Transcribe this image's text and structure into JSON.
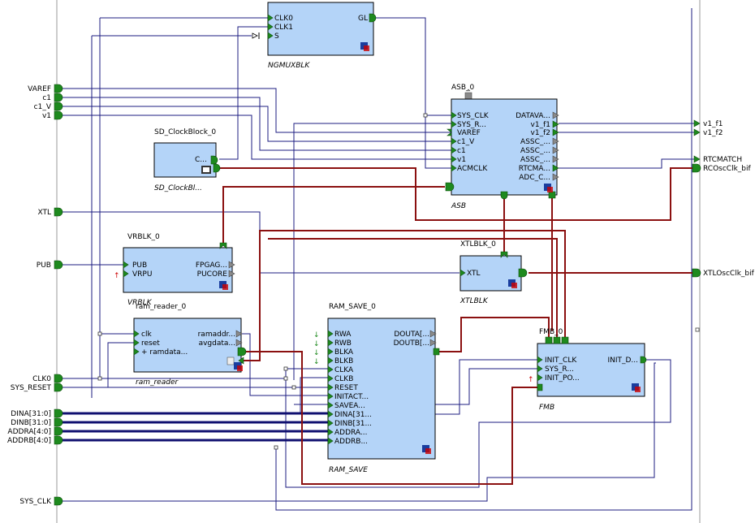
{
  "ports_left": {
    "varef": "VAREF",
    "c1": "c1",
    "c1_v": "c1_V",
    "v1": "v1",
    "xtl": "XTL",
    "pub": "PUB",
    "clk0": "CLK0",
    "sys_reset": "SYS_RESET",
    "dina": "DINA[31:0]",
    "dinb": "DINB[31:0]",
    "addra": "ADDRA[4:0]",
    "addrb": "ADDRB[4:0]",
    "sys_clk": "SYS_CLK"
  },
  "ports_right": {
    "v1_f1": "v1_f1",
    "v1_f2": "v1_f2",
    "rtcmatch": "RTCMATCH",
    "rcosc": "RCOscClk_bif",
    "xtlosc": "XTLOscClk_bif"
  },
  "ngmux": {
    "name": "NGMUXBLK",
    "pins": [
      "CLK0",
      "CLK1",
      "S"
    ],
    "out": "GL"
  },
  "asb": {
    "inst": "ASB_0",
    "name": "ASB",
    "inputs": [
      "SYS_CLK",
      "SYS_R...",
      "VAREF",
      "c1_V",
      "c1",
      "v1",
      "ACMCLK"
    ],
    "outputs": [
      "DATAVA...",
      "v1_f1",
      "v1_f2",
      "ASSC_...",
      "ASSC_...",
      "ASSC_...",
      "RTCMA...",
      "ADC_C..."
    ]
  },
  "sdclock": {
    "inst": "SD_ClockBlock_0",
    "name": "SD_ClockBl...",
    "out": "C..."
  },
  "vrblk": {
    "inst": "VRBLK_0",
    "name": "VRBLK",
    "inputs": [
      "PUB",
      "VRPU"
    ],
    "outputs": [
      "FPGAG...",
      "PUCORE"
    ]
  },
  "ram_reader": {
    "inst": "ram_reader_0",
    "name": "ram_reader",
    "inputs": [
      "clk",
      "reset",
      "+ ramdata..."
    ],
    "outputs": [
      "ramaddr...",
      "avgdata..."
    ]
  },
  "ram_save": {
    "inst": "RAM_SAVE_0",
    "name": "RAM_SAVE",
    "inputs": [
      "RWA",
      "RWB",
      "BLKA",
      "BLKB",
      "CLKA",
      "CLKB",
      "RESET",
      "INITACT...",
      "SAVEA...",
      "DINA[31...",
      "DINB[31...",
      "ADDRA...",
      "ADDRB..."
    ],
    "outputs": [
      "DOUTA[...",
      "DOUTB[..."
    ]
  },
  "xtlblk": {
    "inst": "XTLBLK_0",
    "name": "XTLBLK",
    "in": "XTL"
  },
  "fmb": {
    "inst": "FMB_0",
    "name": "FMB",
    "inputs": [
      "INIT_CLK",
      "SYS_R...",
      "INIT_PO..."
    ],
    "out": "INIT_D..."
  },
  "colors": {
    "block_fill": "#b4d4f8",
    "pin": "#1e8a1e",
    "wire": "#1c1c82",
    "bus_red": "#8b1010"
  }
}
